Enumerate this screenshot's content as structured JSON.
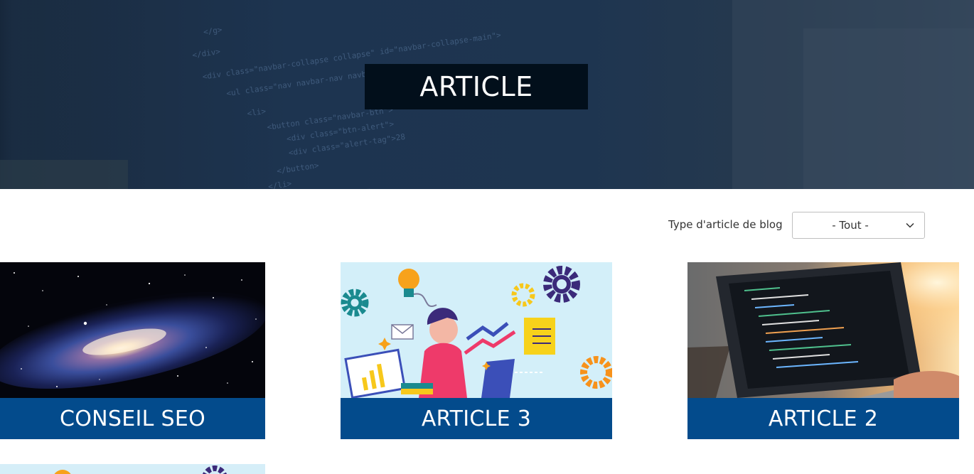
{
  "hero": {
    "title": "ARTICLE"
  },
  "filter": {
    "label": "Type d'article de blog",
    "selected": "- Tout -",
    "icon": "chevron-down-icon"
  },
  "cards": [
    {
      "title": "CONSEIL SEO",
      "image": "galaxy"
    },
    {
      "title": "ARTICLE 3",
      "image": "marketing-illustration"
    },
    {
      "title": "ARTICLE 2",
      "image": "laptop-code"
    }
  ],
  "colors": {
    "caption_bg": "#034b8c",
    "hero_title_bg": "#020f1b"
  }
}
